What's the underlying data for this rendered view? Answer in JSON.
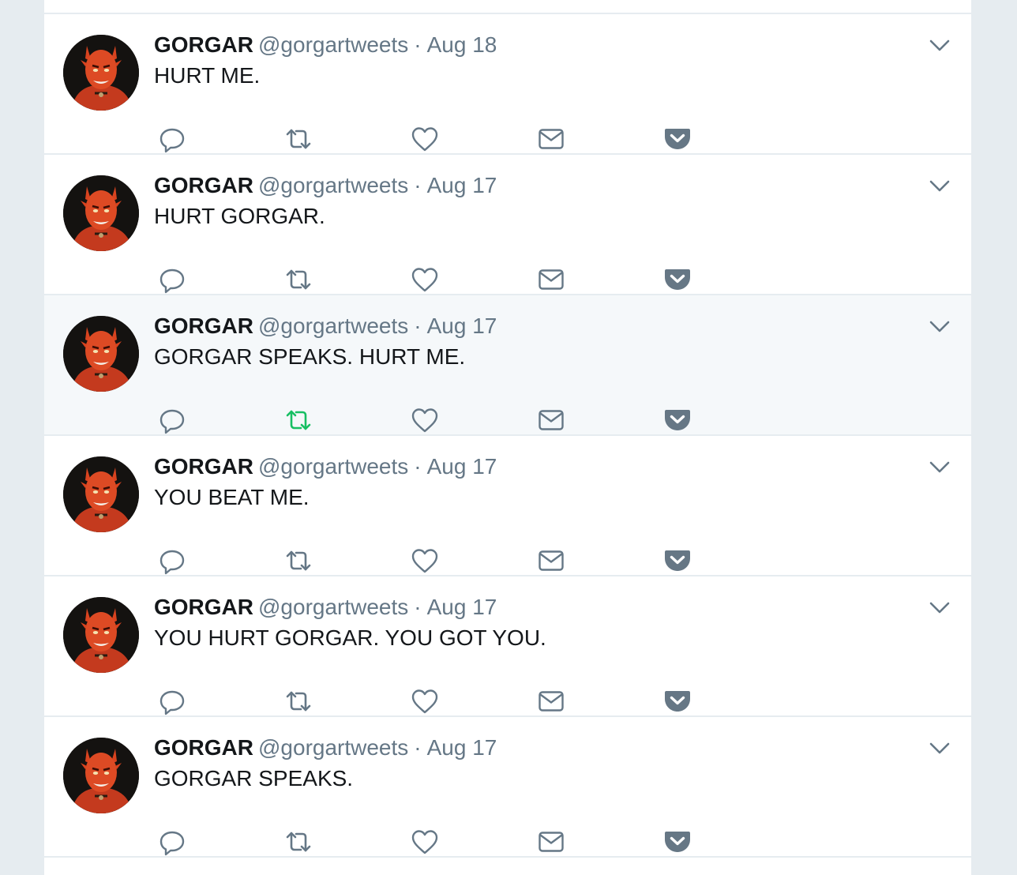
{
  "colors": {
    "accent_retweeted": "#17bf63",
    "icon": "#657786",
    "pocket": "#667785",
    "hover_bg": "#f5f8fa"
  },
  "actions": {
    "reply_icon": "reply-icon",
    "retweet_icon": "retweet-icon",
    "like_icon": "heart-icon",
    "dm_icon": "envelope-icon",
    "pocket_icon": "pocket-icon",
    "more_icon": "chevron-down-icon"
  },
  "tweets": [
    {
      "name": "GORGAR",
      "handle": "@gorgartweets",
      "separator": "·",
      "date": "Aug 18",
      "text": "HURT ME.",
      "retweeted": false,
      "hovered": false
    },
    {
      "name": "GORGAR",
      "handle": "@gorgartweets",
      "separator": "·",
      "date": "Aug 17",
      "text": "HURT GORGAR.",
      "retweeted": false,
      "hovered": false
    },
    {
      "name": "GORGAR",
      "handle": "@gorgartweets",
      "separator": "·",
      "date": "Aug 17",
      "text": "GORGAR SPEAKS. HURT ME.",
      "retweeted": true,
      "hovered": true
    },
    {
      "name": "GORGAR",
      "handle": "@gorgartweets",
      "separator": "·",
      "date": "Aug 17",
      "text": "YOU BEAT ME.",
      "retweeted": false,
      "hovered": false
    },
    {
      "name": "GORGAR",
      "handle": "@gorgartweets",
      "separator": "·",
      "date": "Aug 17",
      "text": "YOU HURT GORGAR. YOU GOT YOU.",
      "retweeted": false,
      "hovered": false
    },
    {
      "name": "GORGAR",
      "handle": "@gorgartweets",
      "separator": "·",
      "date": "Aug 17",
      "text": "GORGAR SPEAKS.",
      "retweeted": false,
      "hovered": false
    }
  ]
}
